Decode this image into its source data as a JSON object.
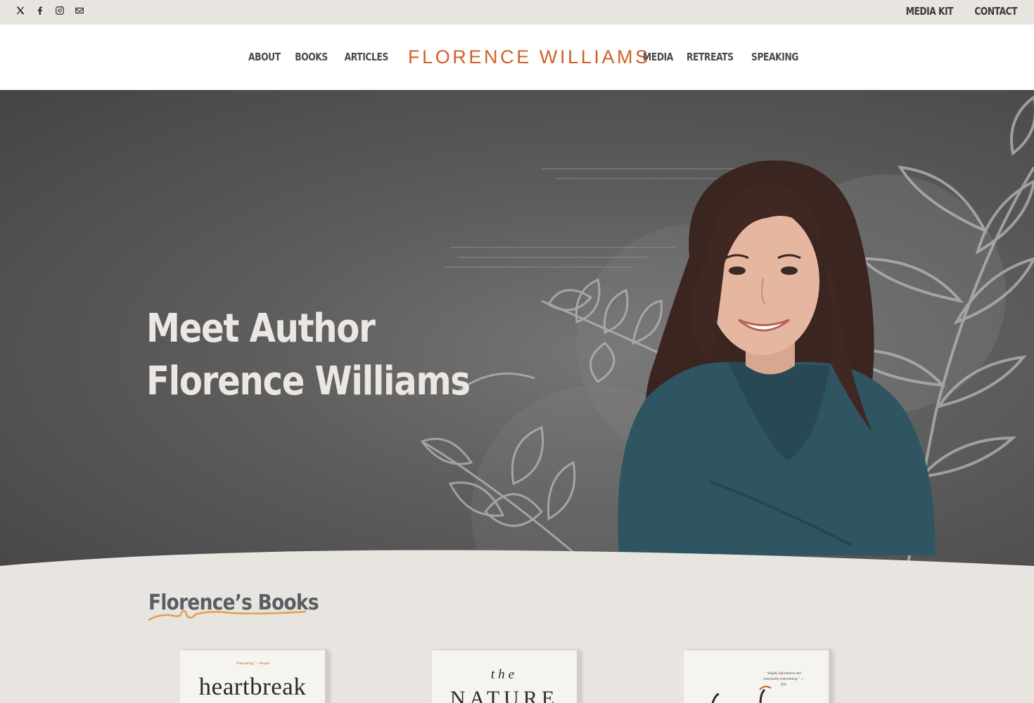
{
  "topbar": {
    "social": [
      "x-icon",
      "facebook-icon",
      "instagram-icon",
      "envelope-icon"
    ],
    "links": [
      "MEDIA KIT",
      "CONTACT"
    ]
  },
  "header": {
    "logo": "FLORENCE WILLIAMS",
    "nav_left": [
      "ABOUT",
      "BOOKS",
      "ARTICLES"
    ],
    "nav_right": [
      "MEDIA",
      "RETREATS",
      "SPEAKING"
    ]
  },
  "hero": {
    "title_line1": "Meet Author",
    "title_line2": "Florence Williams"
  },
  "books": {
    "heading": "Florence’s Books",
    "items": [
      {
        "quote": "“Fascinating.” —People",
        "title": "heartbreak"
      },
      {
        "pre": "the",
        "title": "NATURE"
      },
      {
        "blurb": "“Highly informative and remarkably entertaining.” —Elle"
      }
    ]
  },
  "colors": {
    "accent": "#d35f28",
    "squiggle": "#e0a04a",
    "background": "#e8e4df",
    "hero_text": "#ece7e0"
  }
}
